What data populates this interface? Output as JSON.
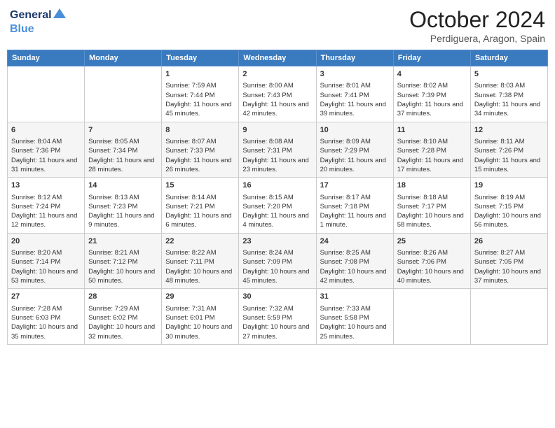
{
  "logo": {
    "general": "General",
    "blue": "Blue"
  },
  "title": "October 2024",
  "location": "Perdiguera, Aragon, Spain",
  "days_of_week": [
    "Sunday",
    "Monday",
    "Tuesday",
    "Wednesday",
    "Thursday",
    "Friday",
    "Saturday"
  ],
  "weeks": [
    [
      {
        "day": "",
        "sunrise": "",
        "sunset": "",
        "daylight": ""
      },
      {
        "day": "",
        "sunrise": "",
        "sunset": "",
        "daylight": ""
      },
      {
        "day": "1",
        "sunrise": "Sunrise: 7:59 AM",
        "sunset": "Sunset: 7:44 PM",
        "daylight": "Daylight: 11 hours and 45 minutes."
      },
      {
        "day": "2",
        "sunrise": "Sunrise: 8:00 AM",
        "sunset": "Sunset: 7:43 PM",
        "daylight": "Daylight: 11 hours and 42 minutes."
      },
      {
        "day": "3",
        "sunrise": "Sunrise: 8:01 AM",
        "sunset": "Sunset: 7:41 PM",
        "daylight": "Daylight: 11 hours and 39 minutes."
      },
      {
        "day": "4",
        "sunrise": "Sunrise: 8:02 AM",
        "sunset": "Sunset: 7:39 PM",
        "daylight": "Daylight: 11 hours and 37 minutes."
      },
      {
        "day": "5",
        "sunrise": "Sunrise: 8:03 AM",
        "sunset": "Sunset: 7:38 PM",
        "daylight": "Daylight: 11 hours and 34 minutes."
      }
    ],
    [
      {
        "day": "6",
        "sunrise": "Sunrise: 8:04 AM",
        "sunset": "Sunset: 7:36 PM",
        "daylight": "Daylight: 11 hours and 31 minutes."
      },
      {
        "day": "7",
        "sunrise": "Sunrise: 8:05 AM",
        "sunset": "Sunset: 7:34 PM",
        "daylight": "Daylight: 11 hours and 28 minutes."
      },
      {
        "day": "8",
        "sunrise": "Sunrise: 8:07 AM",
        "sunset": "Sunset: 7:33 PM",
        "daylight": "Daylight: 11 hours and 26 minutes."
      },
      {
        "day": "9",
        "sunrise": "Sunrise: 8:08 AM",
        "sunset": "Sunset: 7:31 PM",
        "daylight": "Daylight: 11 hours and 23 minutes."
      },
      {
        "day": "10",
        "sunrise": "Sunrise: 8:09 AM",
        "sunset": "Sunset: 7:29 PM",
        "daylight": "Daylight: 11 hours and 20 minutes."
      },
      {
        "day": "11",
        "sunrise": "Sunrise: 8:10 AM",
        "sunset": "Sunset: 7:28 PM",
        "daylight": "Daylight: 11 hours and 17 minutes."
      },
      {
        "day": "12",
        "sunrise": "Sunrise: 8:11 AM",
        "sunset": "Sunset: 7:26 PM",
        "daylight": "Daylight: 11 hours and 15 minutes."
      }
    ],
    [
      {
        "day": "13",
        "sunrise": "Sunrise: 8:12 AM",
        "sunset": "Sunset: 7:24 PM",
        "daylight": "Daylight: 11 hours and 12 minutes."
      },
      {
        "day": "14",
        "sunrise": "Sunrise: 8:13 AM",
        "sunset": "Sunset: 7:23 PM",
        "daylight": "Daylight: 11 hours and 9 minutes."
      },
      {
        "day": "15",
        "sunrise": "Sunrise: 8:14 AM",
        "sunset": "Sunset: 7:21 PM",
        "daylight": "Daylight: 11 hours and 6 minutes."
      },
      {
        "day": "16",
        "sunrise": "Sunrise: 8:15 AM",
        "sunset": "Sunset: 7:20 PM",
        "daylight": "Daylight: 11 hours and 4 minutes."
      },
      {
        "day": "17",
        "sunrise": "Sunrise: 8:17 AM",
        "sunset": "Sunset: 7:18 PM",
        "daylight": "Daylight: 11 hours and 1 minute."
      },
      {
        "day": "18",
        "sunrise": "Sunrise: 8:18 AM",
        "sunset": "Sunset: 7:17 PM",
        "daylight": "Daylight: 10 hours and 58 minutes."
      },
      {
        "day": "19",
        "sunrise": "Sunrise: 8:19 AM",
        "sunset": "Sunset: 7:15 PM",
        "daylight": "Daylight: 10 hours and 56 minutes."
      }
    ],
    [
      {
        "day": "20",
        "sunrise": "Sunrise: 8:20 AM",
        "sunset": "Sunset: 7:14 PM",
        "daylight": "Daylight: 10 hours and 53 minutes."
      },
      {
        "day": "21",
        "sunrise": "Sunrise: 8:21 AM",
        "sunset": "Sunset: 7:12 PM",
        "daylight": "Daylight: 10 hours and 50 minutes."
      },
      {
        "day": "22",
        "sunrise": "Sunrise: 8:22 AM",
        "sunset": "Sunset: 7:11 PM",
        "daylight": "Daylight: 10 hours and 48 minutes."
      },
      {
        "day": "23",
        "sunrise": "Sunrise: 8:24 AM",
        "sunset": "Sunset: 7:09 PM",
        "daylight": "Daylight: 10 hours and 45 minutes."
      },
      {
        "day": "24",
        "sunrise": "Sunrise: 8:25 AM",
        "sunset": "Sunset: 7:08 PM",
        "daylight": "Daylight: 10 hours and 42 minutes."
      },
      {
        "day": "25",
        "sunrise": "Sunrise: 8:26 AM",
        "sunset": "Sunset: 7:06 PM",
        "daylight": "Daylight: 10 hours and 40 minutes."
      },
      {
        "day": "26",
        "sunrise": "Sunrise: 8:27 AM",
        "sunset": "Sunset: 7:05 PM",
        "daylight": "Daylight: 10 hours and 37 minutes."
      }
    ],
    [
      {
        "day": "27",
        "sunrise": "Sunrise: 7:28 AM",
        "sunset": "Sunset: 6:03 PM",
        "daylight": "Daylight: 10 hours and 35 minutes."
      },
      {
        "day": "28",
        "sunrise": "Sunrise: 7:29 AM",
        "sunset": "Sunset: 6:02 PM",
        "daylight": "Daylight: 10 hours and 32 minutes."
      },
      {
        "day": "29",
        "sunrise": "Sunrise: 7:31 AM",
        "sunset": "Sunset: 6:01 PM",
        "daylight": "Daylight: 10 hours and 30 minutes."
      },
      {
        "day": "30",
        "sunrise": "Sunrise: 7:32 AM",
        "sunset": "Sunset: 5:59 PM",
        "daylight": "Daylight: 10 hours and 27 minutes."
      },
      {
        "day": "31",
        "sunrise": "Sunrise: 7:33 AM",
        "sunset": "Sunset: 5:58 PM",
        "daylight": "Daylight: 10 hours and 25 minutes."
      },
      {
        "day": "",
        "sunrise": "",
        "sunset": "",
        "daylight": ""
      },
      {
        "day": "",
        "sunrise": "",
        "sunset": "",
        "daylight": ""
      }
    ]
  ]
}
